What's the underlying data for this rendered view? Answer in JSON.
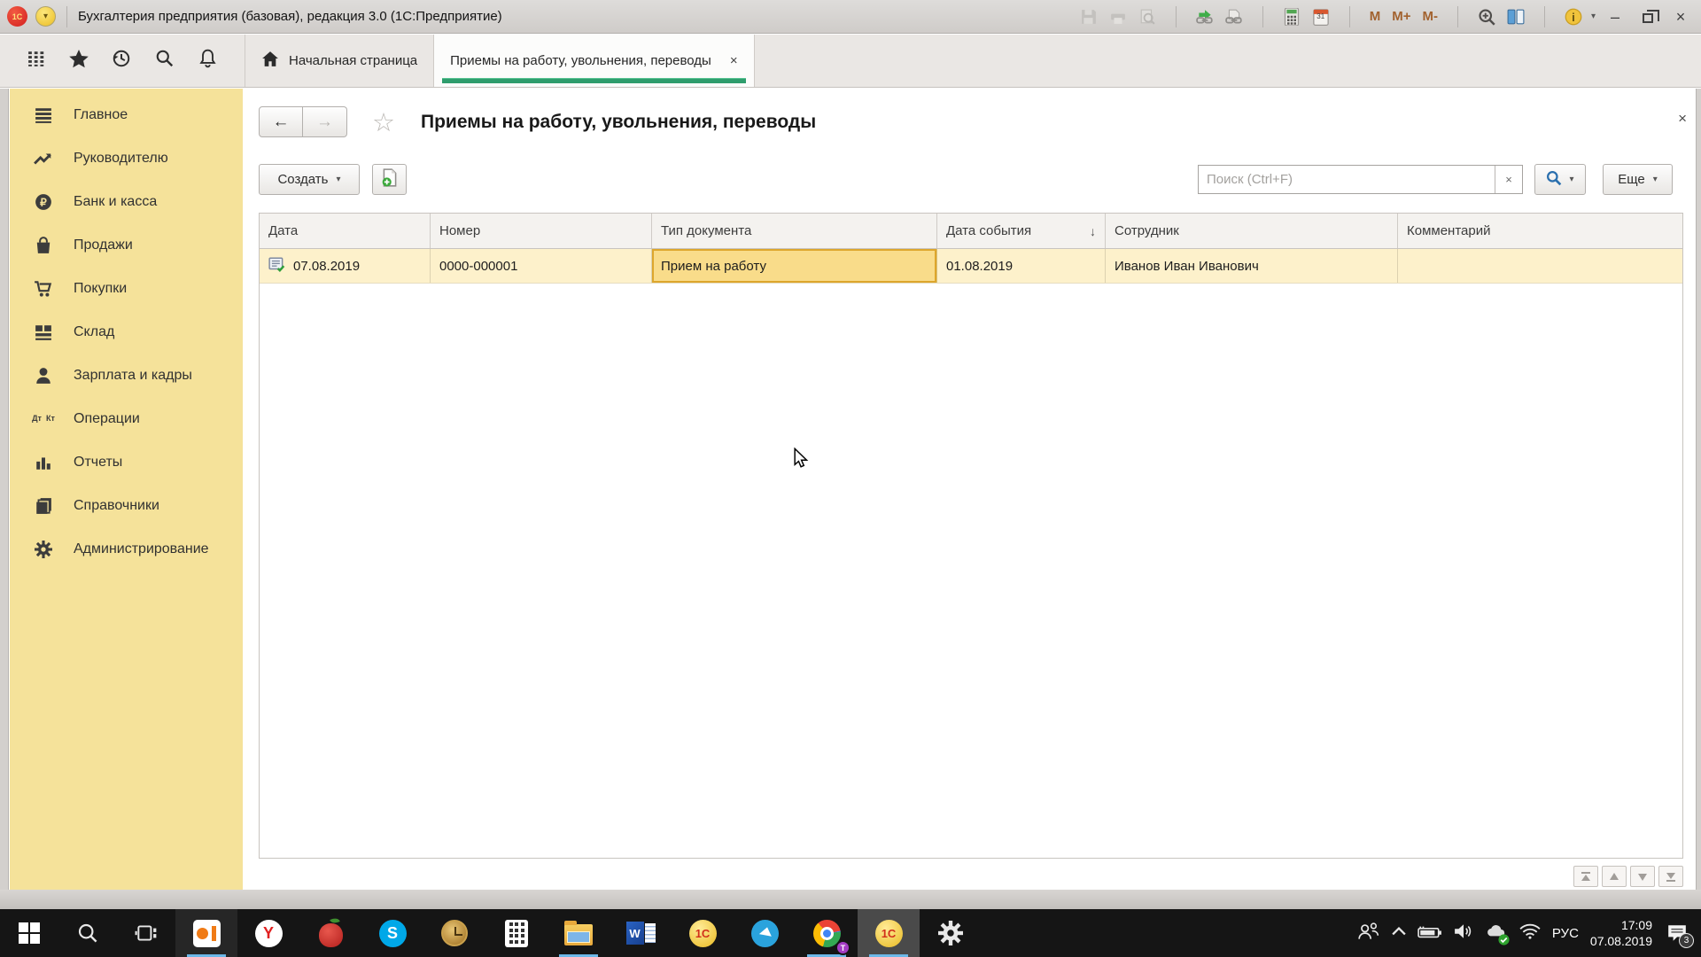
{
  "titlebar": {
    "logo": "1С",
    "caret": "▾",
    "title": "Бухгалтерия предприятия (базовая), редакция 3.0  (1С:Предприятие)",
    "memory_buttons": [
      "M",
      "M+",
      "M-"
    ],
    "calendar_day": "31",
    "minimize": "–",
    "close": "×"
  },
  "tabbar": {
    "home_tab": "Начальная страница",
    "active_tab": "Приемы на работу, увольнения, переводы",
    "active_tab_close": "×"
  },
  "sidebar": {
    "items": [
      {
        "label": "Главное"
      },
      {
        "label": "Руководителю"
      },
      {
        "label": "Банк и касса"
      },
      {
        "label": "Продажи"
      },
      {
        "label": "Покупки"
      },
      {
        "label": "Склад"
      },
      {
        "label": "Зарплата и кадры"
      },
      {
        "label": "Операции",
        "icon_top": "Дт",
        "icon_bottom": "Кт"
      },
      {
        "label": "Отчеты"
      },
      {
        "label": "Справочники"
      },
      {
        "label": "Администрирование"
      }
    ]
  },
  "page": {
    "title": "Приемы на работу, увольнения, переводы",
    "back": "←",
    "forward": "→",
    "favorite_star": "☆",
    "close": "×",
    "toolbar": {
      "create_label": "Создать",
      "caret": "▾",
      "search_placeholder": "Поиск (Ctrl+F)",
      "search_clear": "×",
      "more_label": "Еще"
    }
  },
  "table": {
    "columns": [
      "Дата",
      "Номер",
      "Тип документа",
      "Дата события",
      "Сотрудник",
      "Комментарий"
    ],
    "sort_indicator": "↓",
    "rows": [
      {
        "date": "07.08.2019",
        "number": "0000-000001",
        "doc_type": "Прием на работу",
        "event_date": "01.08.2019",
        "employee": "Иванов Иван Иванович",
        "comment": ""
      }
    ]
  },
  "taskbar": {
    "letters": {
      "yandex": "Y",
      "skype": "S",
      "word": "W",
      "onec": "1С",
      "chrome_badge": "T"
    },
    "tray": {
      "language": "РУС",
      "time": "17:09",
      "date": "07.08.2019",
      "notification_count": "3"
    }
  },
  "colors": {
    "accent_green": "#2f9d6d",
    "sidebar_yellow": "#f5e29a",
    "row_yellow": "#fdf1cb",
    "selected_cell_yellow": "#f9dc8a",
    "selected_cell_border": "#dda62c",
    "taskbar_underline": "#6cb8e8"
  }
}
